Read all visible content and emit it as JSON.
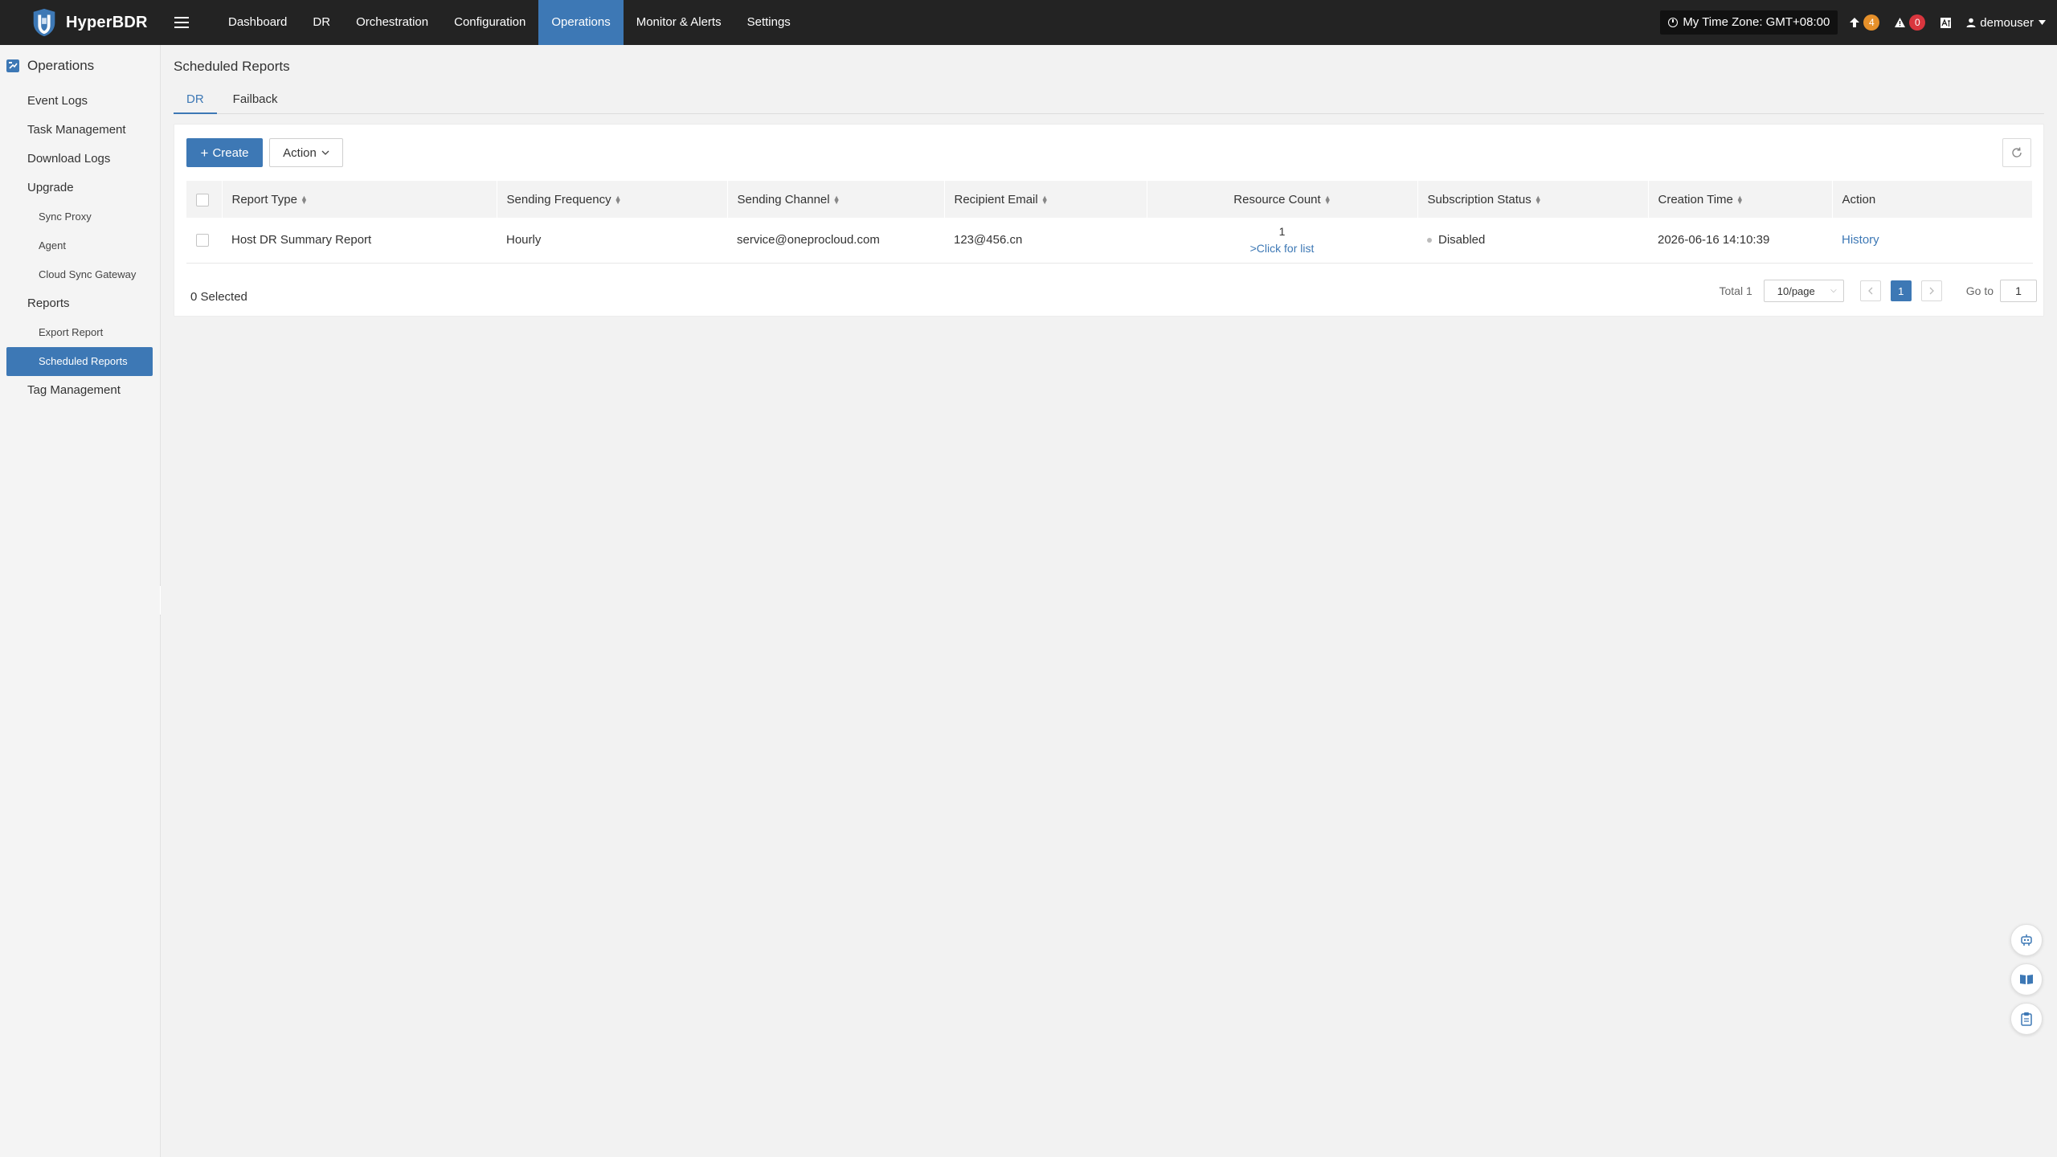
{
  "app": {
    "name": "HyperBDR"
  },
  "nav": {
    "items": [
      {
        "label": "Dashboard"
      },
      {
        "label": "DR"
      },
      {
        "label": "Orchestration"
      },
      {
        "label": "Configuration"
      },
      {
        "label": "Operations",
        "active": true
      },
      {
        "label": "Monitor & Alerts"
      },
      {
        "label": "Settings"
      }
    ]
  },
  "topbar": {
    "timezone": "My Time Zone: GMT+08:00",
    "upgrade_count": "4",
    "alert_count": "0",
    "user": "demouser"
  },
  "sidebar": {
    "section": "Operations",
    "items": {
      "event_logs": "Event Logs",
      "task_management": "Task Management",
      "download_logs": "Download Logs",
      "upgrade": "Upgrade",
      "sync_proxy": "Sync Proxy",
      "agent": "Agent",
      "cloud_sync_gateway": "Cloud Sync Gateway",
      "reports": "Reports",
      "export_report": "Export Report",
      "scheduled_reports": "Scheduled Reports",
      "tag_management": "Tag Management"
    }
  },
  "page": {
    "title": "Scheduled Reports",
    "tabs": [
      {
        "label": "DR",
        "active": true
      },
      {
        "label": "Failback"
      }
    ]
  },
  "toolbar": {
    "create_label": "Create",
    "action_label": "Action"
  },
  "table": {
    "headers": {
      "report_type": "Report Type",
      "sending_frequency": "Sending Frequency",
      "sending_channel": "Sending Channel",
      "recipient_email": "Recipient Email",
      "resource_count": "Resource Count",
      "subscription_status": "Subscription Status",
      "creation_time": "Creation Time",
      "action": "Action"
    },
    "rows": [
      {
        "report_type": "Host DR Summary Report",
        "sending_frequency": "Hourly",
        "sending_channel": "service@oneprocloud.com",
        "recipient_email": "123@456.cn",
        "resource_count": "1",
        "resource_link": ">Click for list",
        "subscription_status": "Disabled",
        "creation_time": "2026-06-16 14:10:39",
        "action": "History"
      }
    ]
  },
  "footer": {
    "selected": "0 Selected",
    "total": "Total 1",
    "page_size": "10/page",
    "current_page": "1",
    "goto_label": "Go to",
    "goto_value": "1"
  },
  "colors": {
    "accent": "#3d78b5",
    "topbar_bg": "#232323",
    "badge_upgrade": "#e6902a",
    "badge_alert": "#d9363e"
  }
}
